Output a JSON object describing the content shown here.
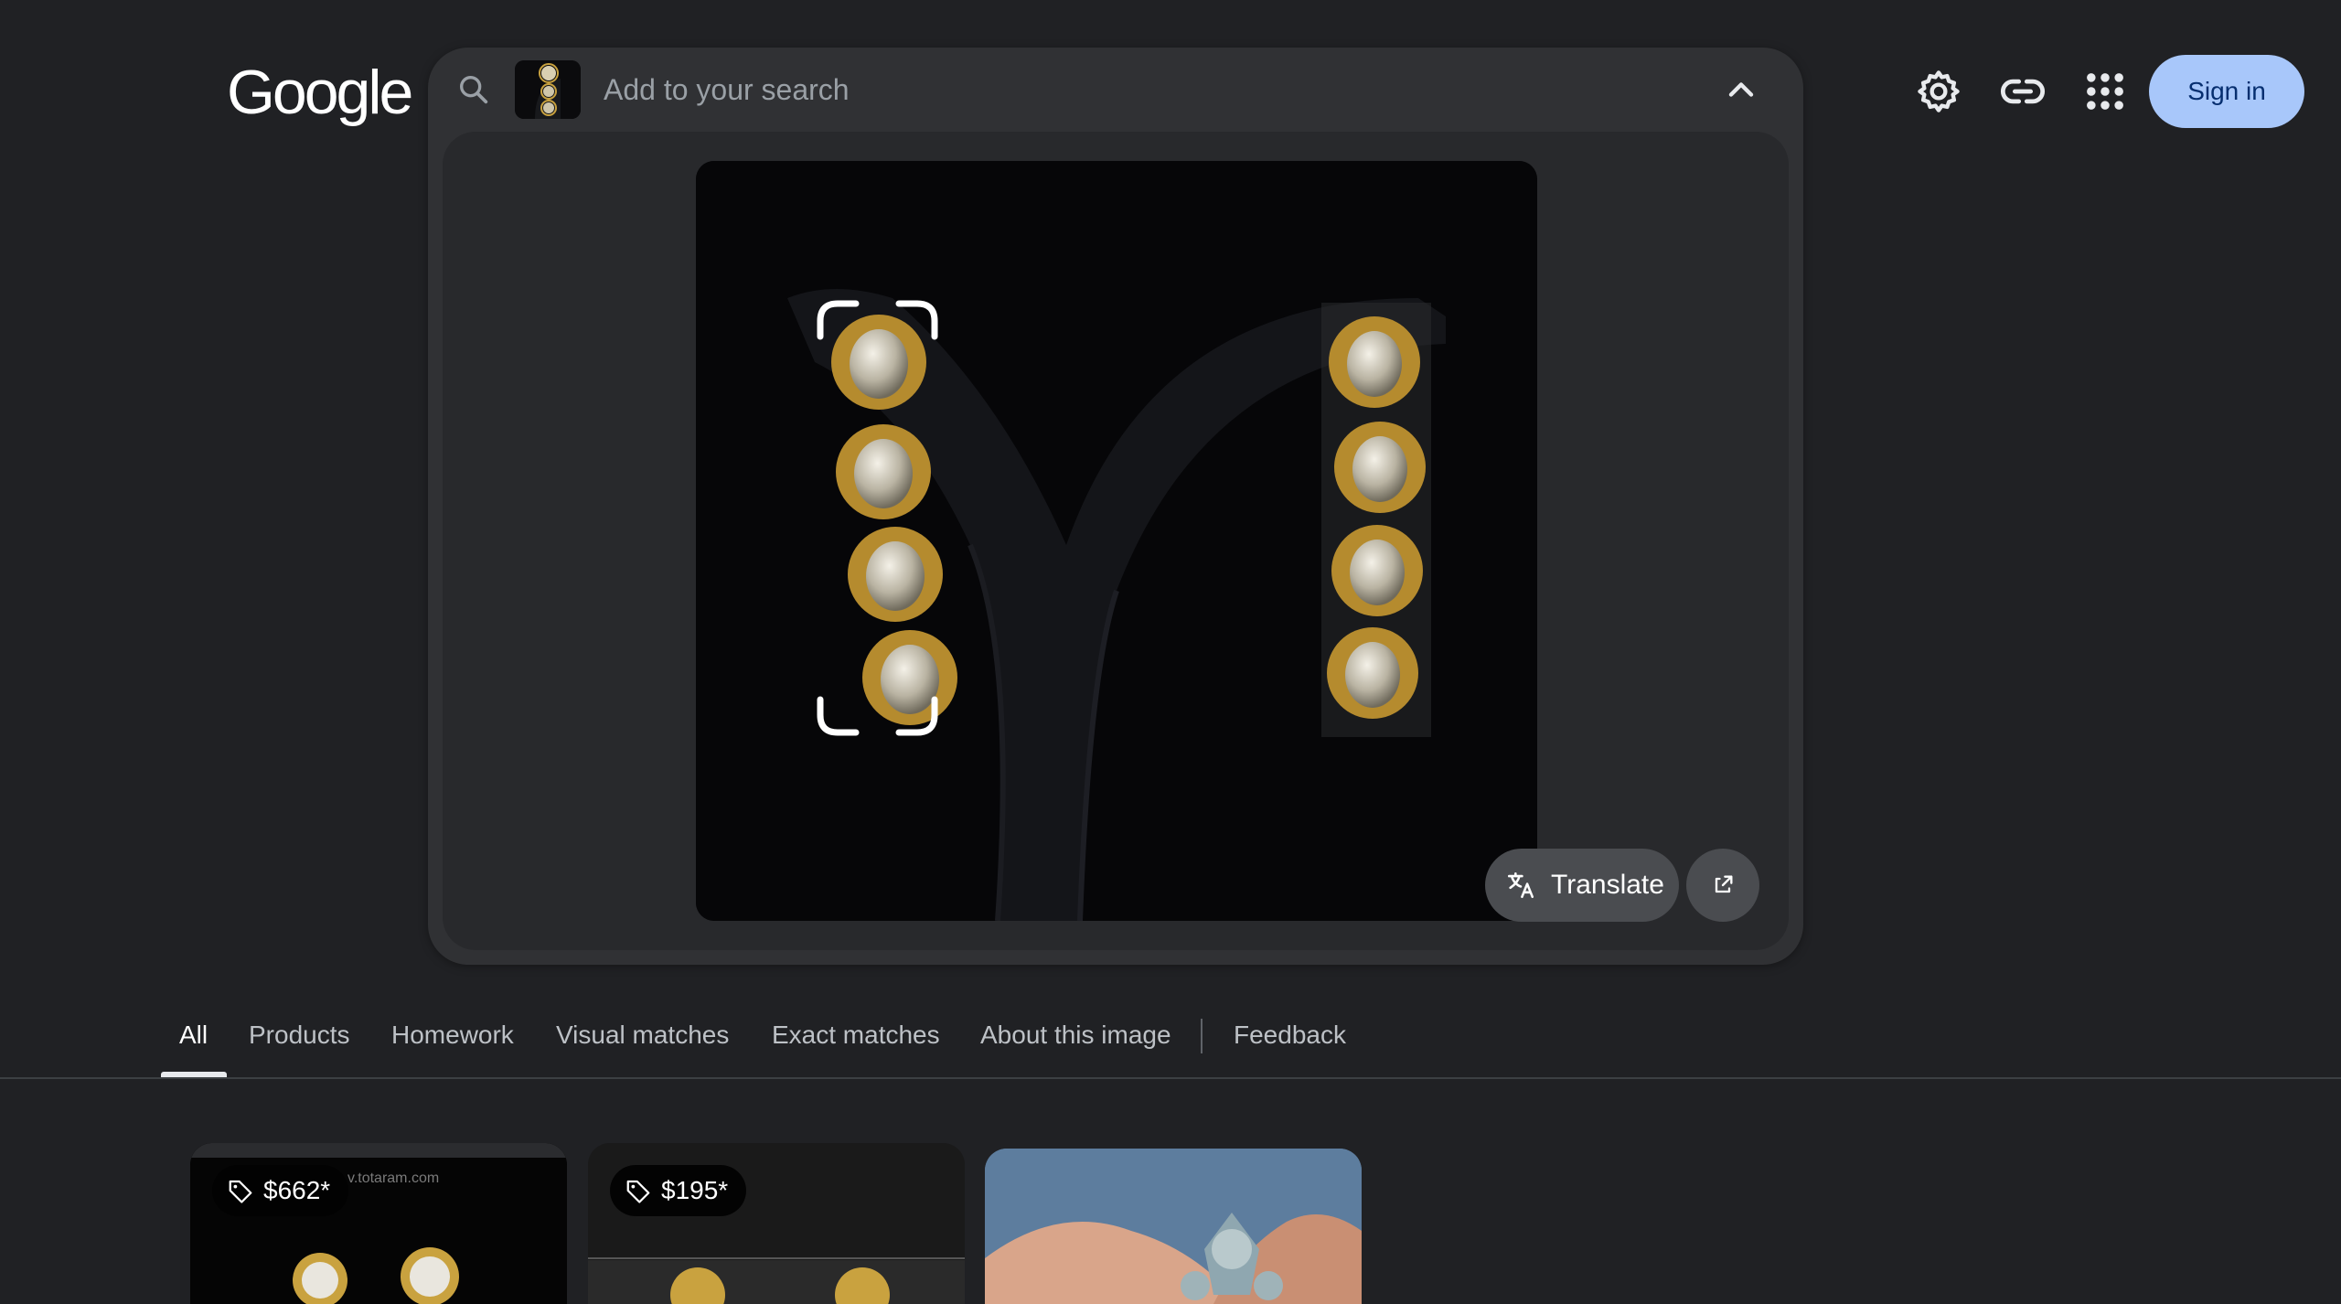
{
  "logo": {
    "text": "Google"
  },
  "search": {
    "placeholder": "Add to your search"
  },
  "image_actions": {
    "translate_label": "Translate"
  },
  "header": {
    "sign_in_label": "Sign in"
  },
  "tabs": [
    {
      "label": "All",
      "active": true
    },
    {
      "label": "Products"
    },
    {
      "label": "Homework"
    },
    {
      "label": "Visual matches"
    },
    {
      "label": "Exact matches"
    },
    {
      "label": "About this image"
    },
    {
      "label": "Feedback"
    }
  ],
  "results": [
    {
      "price": "$662*",
      "watermark": "v.totaram.com"
    },
    {
      "price": "$195*"
    },
    {
      "price": ""
    }
  ],
  "colors": {
    "background": "#202124",
    "panel": "#303134",
    "sign_in_bg": "#a8c7fa",
    "gold": "#c9a23f"
  },
  "icons": [
    "search-icon",
    "chevron-up-icon",
    "translate-icon",
    "expand-icon",
    "settings-icon",
    "link-icon",
    "apps-grid-icon",
    "price-tag-icon"
  ]
}
